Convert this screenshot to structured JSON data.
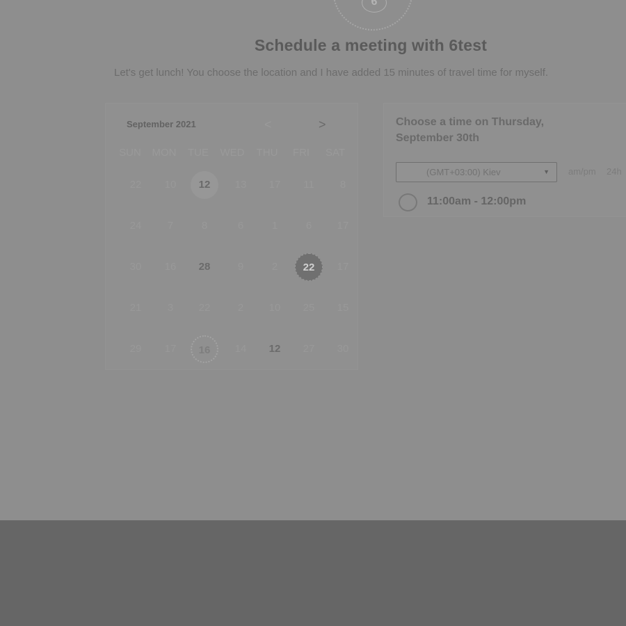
{
  "avatar_text": "6",
  "title": "Schedule a meeting with 6test",
  "description": "Let's get lunch! You choose the location and I have added 15 minutes of travel time for myself.",
  "calendar": {
    "month_label": "September 2021",
    "prev_icon": "<",
    "next_icon": ">",
    "weekdays": [
      "SUN",
      "MON",
      "TUE",
      "WED",
      "THU",
      "FRI",
      "SAT"
    ],
    "weeks": [
      [
        "22",
        "10",
        "12",
        "13",
        "17",
        "11",
        "8"
      ],
      [
        "24",
        "7",
        "8",
        "6",
        "1",
        "6",
        "17"
      ],
      [
        "30",
        "16",
        "28",
        "9",
        "2",
        "22",
        "17"
      ],
      [
        "21",
        "3",
        "22",
        "2",
        "10",
        "25",
        "15"
      ],
      [
        "29",
        "17",
        "16",
        "14",
        "12",
        "27",
        "30"
      ]
    ]
  },
  "time_panel": {
    "title": "Choose a time on Thursday, September 30th",
    "timezone": "(GMT+03:00) Kiev",
    "format_ampm": "am/pm",
    "format_24h": "24h",
    "slot_label": "11:00am - 12:00pm"
  }
}
